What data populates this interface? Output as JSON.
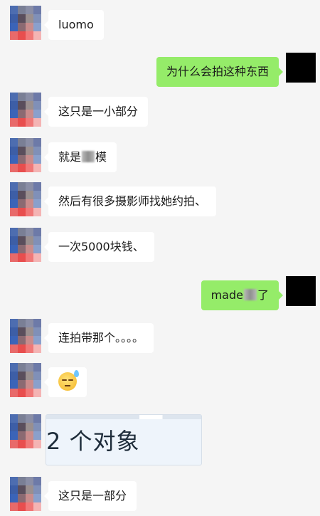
{
  "messages": [
    {
      "side": "left",
      "text": "luomo"
    },
    {
      "side": "right",
      "text": "为什么会拍这种东西"
    },
    {
      "side": "left",
      "text": "这只是一小部分"
    },
    {
      "side": "left",
      "text_before": "就是",
      "text_after": "模"
    },
    {
      "side": "left",
      "text": "然后有很多摄影师找她约拍、"
    },
    {
      "side": "left",
      "text": "一次5000块钱、"
    },
    {
      "side": "right",
      "text_before": "made",
      "text_after": "了"
    },
    {
      "side": "left",
      "text": "连拍带那个。。。。"
    },
    {
      "side": "left",
      "emoji": "sweat-smile-emoji"
    },
    {
      "side": "left",
      "image_text": "2 个对象"
    },
    {
      "side": "left",
      "text": "这只是一部分"
    }
  ],
  "colors": {
    "background": "#f5f5f5",
    "sent_bubble": "#95ec69",
    "received_bubble": "#ffffff",
    "self_avatar": "#000000"
  }
}
